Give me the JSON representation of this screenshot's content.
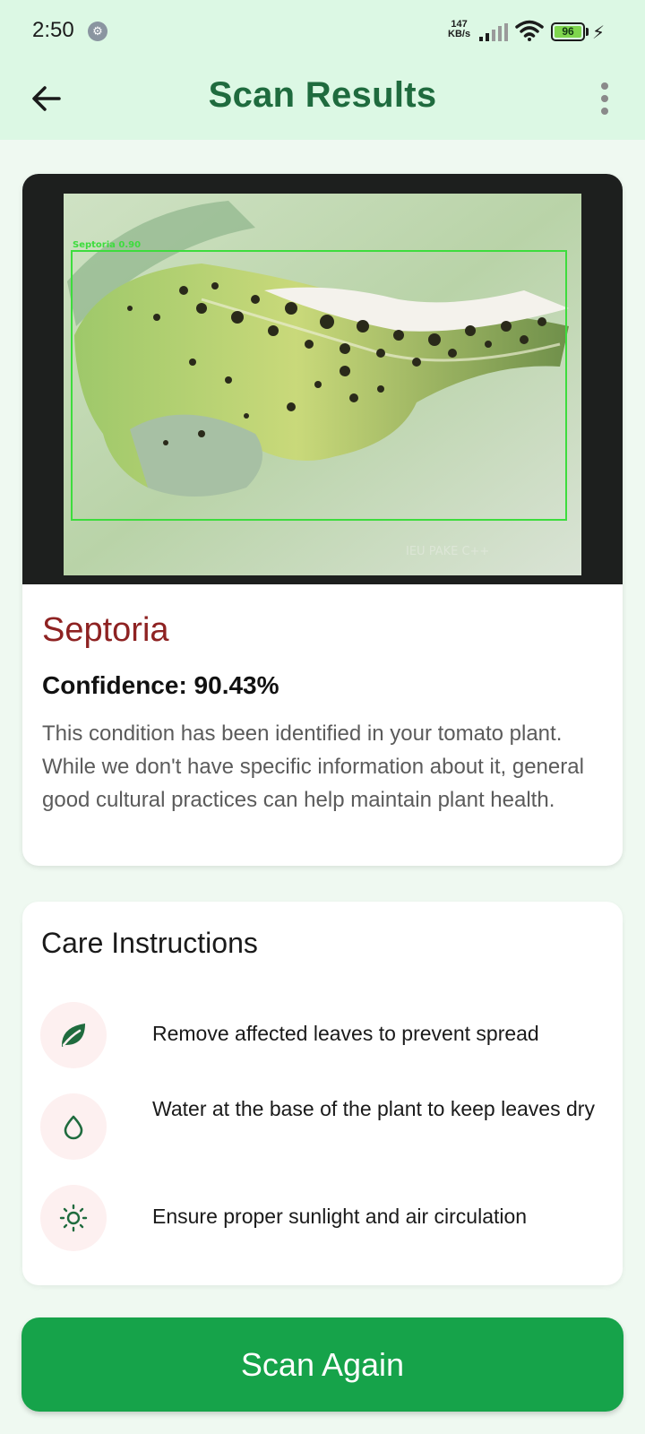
{
  "status_bar": {
    "time": "2:50",
    "net_speed_value": "147",
    "net_speed_unit": "KB/s",
    "battery": "96"
  },
  "app_bar": {
    "title": "Scan Results",
    "back_icon": "arrow-left-icon",
    "menu_icon": "more-vert-icon"
  },
  "result": {
    "image_label": "Septoria 0.90",
    "image_watermark": "IEU PAKE C++",
    "disease": "Septoria",
    "confidence": "Confidence: 90.43%",
    "description": "This condition has been identified in your tomato plant. While we don't have specific information about it, general good cultural practices can help maintain plant health."
  },
  "care": {
    "title": "Care Instructions",
    "items": [
      {
        "icon": "leaf-icon",
        "text": "Remove affected leaves to prevent spread"
      },
      {
        "icon": "water-drop-icon",
        "text": "Water at the base of the plant to keep leaves dry"
      },
      {
        "icon": "sun-icon",
        "text": "Ensure proper sunlight and air circulation"
      }
    ]
  },
  "actions": {
    "scan_again": "Scan Again"
  },
  "colors": {
    "title_green": "#1f6b3e",
    "disease_red": "#8e2222",
    "button_green": "#16a34a",
    "detection_box": "#3ddc3d"
  }
}
